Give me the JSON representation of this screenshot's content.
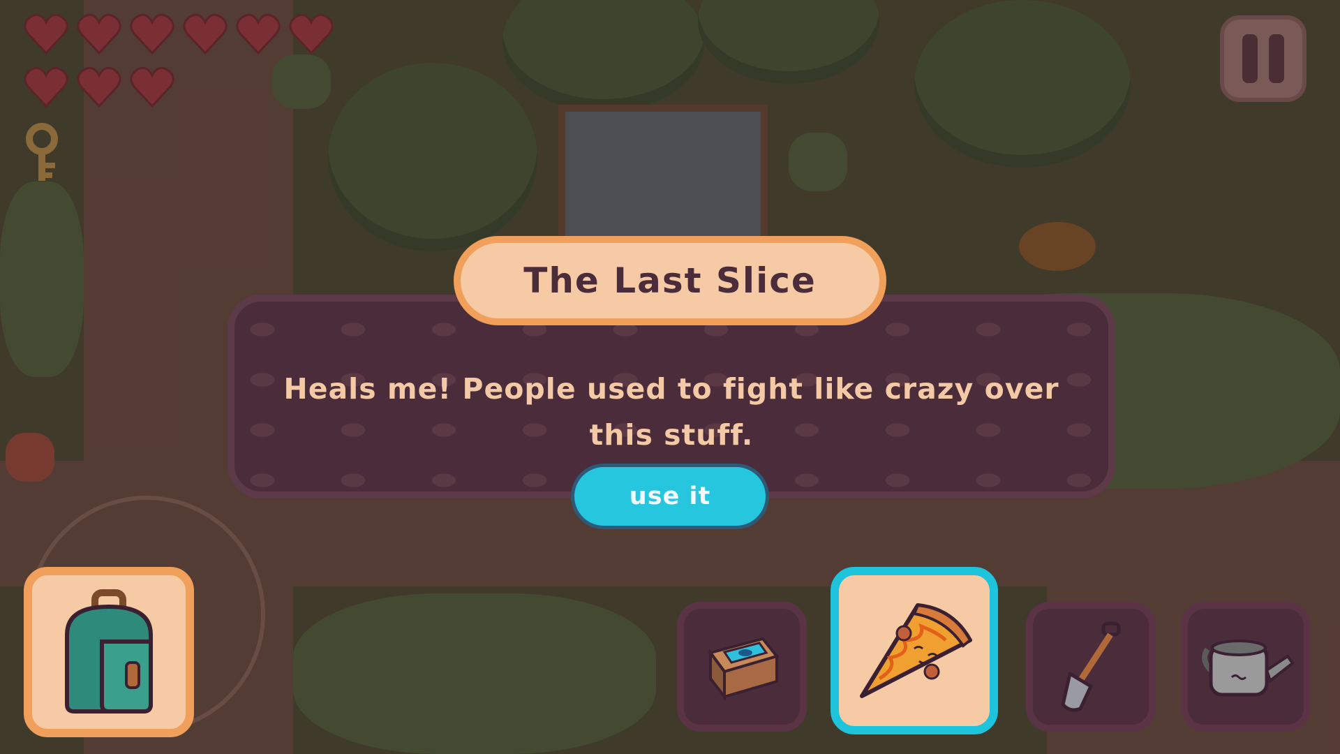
{
  "hud": {
    "hearts_filled": 9,
    "hearts_total": 9,
    "key_icon": "key-icon",
    "pause_icon": "pause-icon"
  },
  "dialog": {
    "title": "The Last Slice",
    "description": "Heals me! People used to fight like crazy over this stuff.",
    "action_label": "use it"
  },
  "hotbar": {
    "items": [
      {
        "name": "backpack",
        "icon": "backpack-icon"
      },
      {
        "name": "gadget-box",
        "icon": "gadget-box-icon"
      },
      {
        "name": "pizza-slice",
        "icon": "pizza-slice-icon",
        "selected": true
      },
      {
        "name": "shovel",
        "icon": "shovel-icon"
      },
      {
        "name": "watering-can",
        "icon": "watering-can-icon"
      }
    ]
  },
  "colors": {
    "dialog_bg": "#4a2c3a",
    "title_bg": "#f5caa5",
    "title_border": "#f0a05a",
    "button_bg": "#26c6de",
    "text_light": "#f4c9a5",
    "selected_border": "#1ec3dc"
  }
}
